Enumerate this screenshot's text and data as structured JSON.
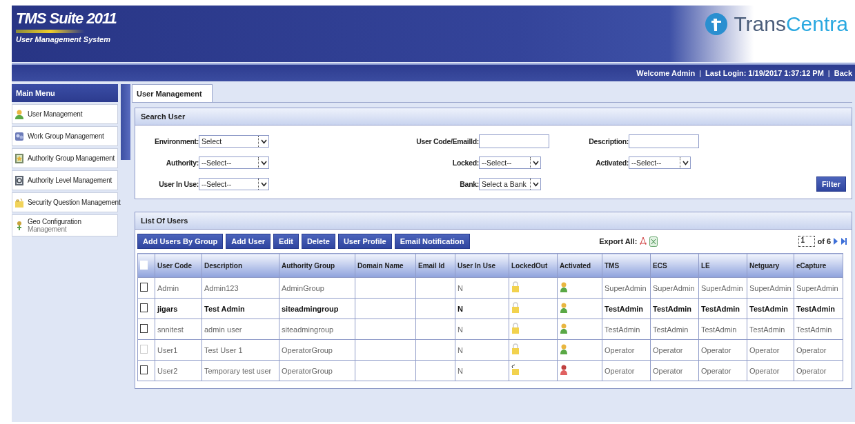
{
  "header": {
    "title": "TMS Suite 2011",
    "subtitle": "User Management System",
    "brand": {
      "first": "Trans",
      "second": "Centra"
    }
  },
  "user_bar": [
    {
      "kind": "text",
      "text": "Welcome Admin"
    },
    {
      "kind": "separator",
      "text": "|"
    },
    {
      "kind": "text",
      "text": "Last Login: 1/19/2017 1:37:12 PM"
    },
    {
      "kind": "separator",
      "text": "|"
    },
    {
      "kind": "link",
      "text": "Back"
    }
  ],
  "sidebar": {
    "title": "Main Menu",
    "items": [
      {
        "kind": "user",
        "label": "User Management"
      },
      {
        "kind": "group",
        "label": "Work Group Management"
      },
      {
        "kind": "authority",
        "label": "Authority Group Management"
      },
      {
        "kind": "level",
        "label": "Authority Level Management"
      },
      {
        "kind": "security",
        "label": "Security Question Management"
      },
      {
        "kind": "geo",
        "label": "Geo Configuration",
        "sublabel": "Management"
      }
    ]
  },
  "tabs": [
    {
      "label": "User Management",
      "selected": true
    }
  ],
  "search": {
    "title": "Search User",
    "columns": [
      [
        {
          "kind": "select",
          "label": "Environment:",
          "value": "Select"
        },
        {
          "kind": "select",
          "label": "Authority:",
          "value": "--Select--"
        },
        {
          "kind": "select",
          "label": "User In Use:",
          "value": "--Select--"
        }
      ],
      [
        {
          "kind": "text",
          "label": "User Code/EmailId:"
        },
        {
          "kind": "select",
          "label": "Locked:",
          "value": "--Select--"
        },
        {
          "kind": "select",
          "label": "Bank:",
          "value": "Select a Bank"
        }
      ],
      [
        {
          "kind": "text",
          "label": "Description:"
        },
        {
          "kind": "select",
          "label": "Activated:",
          "value": "--Select--"
        }
      ]
    ],
    "button": "Filter"
  },
  "users": {
    "title": "List Of Users",
    "buttons": [
      "Add Users By Group",
      "Add User",
      "Edit",
      "Delete",
      "User Profile",
      "Email Notification"
    ],
    "select_all_checked": false,
    "export_label": "Export All:",
    "pager": {
      "page": "1",
      "total": "of 6"
    },
    "columns": [
      {
        "kind": "check"
      },
      {
        "kind": "text",
        "label": "User Code"
      },
      {
        "kind": "text",
        "label": "Description"
      },
      {
        "kind": "text",
        "label": "Authority Group"
      },
      {
        "kind": "blank",
        "label": "Domain Name"
      },
      {
        "kind": "blank",
        "label": "Email Id"
      },
      {
        "kind": "text",
        "label": "User In Use"
      },
      {
        "kind": "lock",
        "label": "LockedOut"
      },
      {
        "kind": "status",
        "label": "Activated"
      },
      {
        "kind": "text",
        "label": "TMS"
      },
      {
        "kind": "text",
        "label": "ECS"
      },
      {
        "kind": "text",
        "label": "LE"
      },
      {
        "kind": "text",
        "label": "Netguary"
      },
      {
        "kind": "text",
        "label": "eCapture"
      }
    ],
    "rows": [
      {
        "checked": false,
        "disabled": false,
        "bold": false,
        "locked_out": false,
        "activated": true,
        "cells": [
          "",
          "Admin",
          "Admin123",
          "AdminGroup",
          "",
          "",
          "N",
          "",
          "",
          "SuperAdmin",
          "SuperAdmin",
          "SuperAdmin",
          "SuperAdmin",
          "SuperAdmin"
        ]
      },
      {
        "checked": false,
        "disabled": false,
        "bold": true,
        "locked_out": false,
        "activated": true,
        "cells": [
          "",
          "jigars",
          "Test Admin",
          "siteadmingroup",
          "",
          "",
          "N",
          "",
          "",
          "TestAdmin",
          "TestAdmin",
          "TestAdmin",
          "TestAdmin",
          "TestAdmin"
        ]
      },
      {
        "checked": false,
        "disabled": false,
        "bold": false,
        "locked_out": false,
        "activated": true,
        "cells": [
          "",
          "snnitest",
          "admin user",
          "siteadmingroup",
          "",
          "",
          "N",
          "",
          "",
          "TestAdmin",
          "TestAdmin",
          "TestAdmin",
          "TestAdmin",
          "TestAdmin"
        ]
      },
      {
        "checked": false,
        "disabled": true,
        "bold": false,
        "locked_out": false,
        "activated": true,
        "cells": [
          "",
          "User1",
          "Test User 1",
          "OperatorGroup",
          "",
          "",
          "N",
          "",
          "",
          "Operator",
          "Operator",
          "Operator",
          "Operator",
          "Operator"
        ]
      },
      {
        "checked": false,
        "disabled": false,
        "bold": false,
        "locked_out": true,
        "activated": false,
        "cells": [
          "",
          "User2",
          "Temporary test user",
          "OperatorGroup",
          "",
          "",
          "N",
          "",
          "",
          "Operator",
          "Operator",
          "Operator",
          "Operator",
          "Operator"
        ]
      }
    ]
  }
}
